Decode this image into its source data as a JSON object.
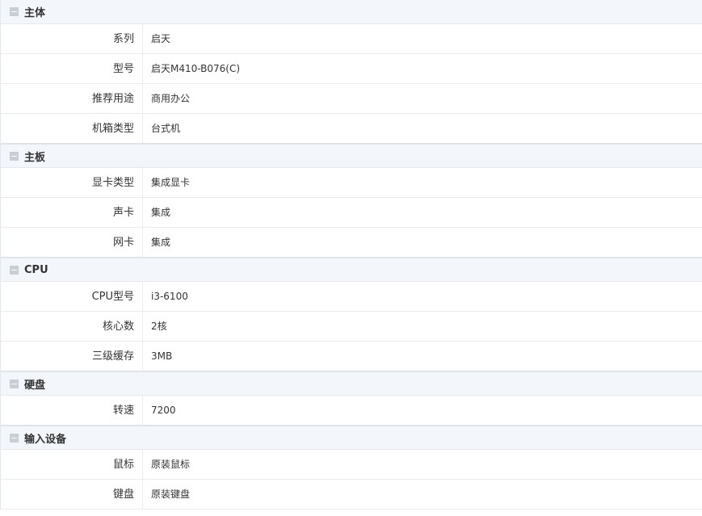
{
  "groups": [
    {
      "title": "主体",
      "rows": [
        {
          "label": "系列",
          "value": "启天"
        },
        {
          "label": "型号",
          "value": "启天M410-B076(C)"
        },
        {
          "label": "推荐用途",
          "value": "商用办公"
        },
        {
          "label": "机箱类型",
          "value": "台式机"
        }
      ]
    },
    {
      "title": "主板",
      "rows": [
        {
          "label": "显卡类型",
          "value": "集成显卡"
        },
        {
          "label": "声卡",
          "value": "集成"
        },
        {
          "label": "网卡",
          "value": "集成"
        }
      ]
    },
    {
      "title": "CPU",
      "rows": [
        {
          "label": "CPU型号",
          "value": "i3-6100"
        },
        {
          "label": "核心数",
          "value": "2核"
        },
        {
          "label": "三级缓存",
          "value": "3MB"
        }
      ]
    },
    {
      "title": "硬盘",
      "rows": [
        {
          "label": "转速",
          "value": "7200"
        }
      ]
    },
    {
      "title": "输入设备",
      "rows": [
        {
          "label": "鼠标",
          "value": "原装鼠标"
        },
        {
          "label": "键盘",
          "value": "原装键盘"
        }
      ]
    }
  ],
  "icons": {
    "collapse": "minus-square-icon"
  },
  "colors": {
    "header_bg": "#f3f7fb",
    "border": "#e3e7ee",
    "icon": "#c8ced6",
    "text": "#333333"
  }
}
